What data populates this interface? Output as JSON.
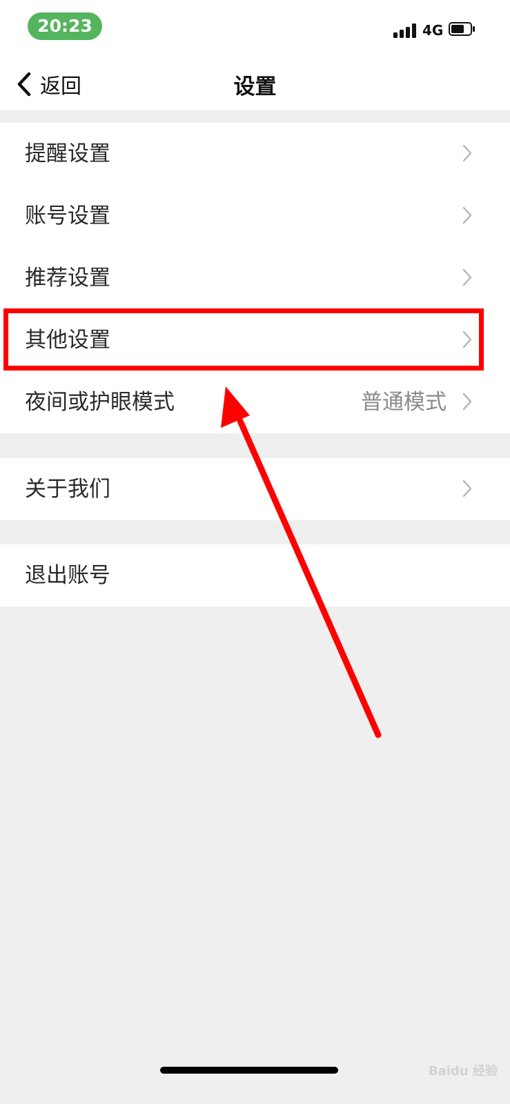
{
  "status_bar": {
    "time": "20:23",
    "network": "4G"
  },
  "nav": {
    "back_label": "返回",
    "title": "设置"
  },
  "settings_groups": [
    {
      "items": [
        {
          "label": "提醒设置",
          "value": ""
        },
        {
          "label": "账号设置",
          "value": ""
        },
        {
          "label": "推荐设置",
          "value": ""
        },
        {
          "label": "其他设置",
          "value": ""
        },
        {
          "label": "夜间或护眼模式",
          "value": "普通模式"
        }
      ]
    },
    {
      "items": [
        {
          "label": "关于我们",
          "value": ""
        }
      ]
    },
    {
      "items": [
        {
          "label": "退出账号",
          "value": ""
        }
      ]
    }
  ],
  "watermark": "Baidu 经验",
  "colors": {
    "accent_green": "#55b45e",
    "annotation_red": "#ff0000",
    "background": "#efefef"
  }
}
